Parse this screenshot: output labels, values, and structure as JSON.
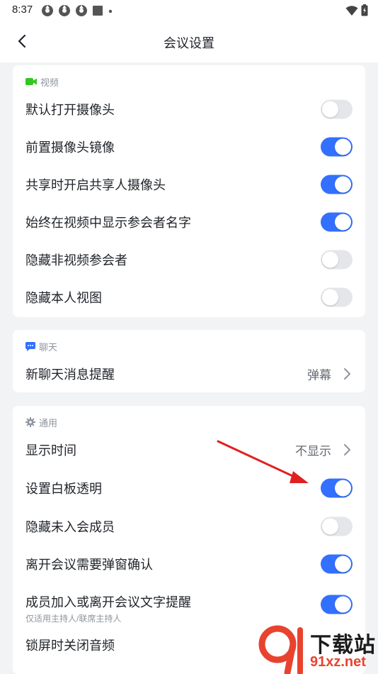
{
  "status_bar": {
    "time": "8:37"
  },
  "header": {
    "title": "会议设置"
  },
  "video_section": {
    "title": "视频",
    "items": [
      {
        "label": "默认打开摄像头",
        "on": false
      },
      {
        "label": "前置摄像头镜像",
        "on": true
      },
      {
        "label": "共享时开启共享人摄像头",
        "on": true
      },
      {
        "label": "始终在视频中显示参会者名字",
        "on": true
      },
      {
        "label": "隐藏非视频参会者",
        "on": false
      },
      {
        "label": "隐藏本人视图",
        "on": false
      }
    ]
  },
  "chat_section": {
    "title": "聊天",
    "items": [
      {
        "label": "新聊天消息提醒",
        "value": "弹幕"
      }
    ]
  },
  "general_section": {
    "title": "通用",
    "items": [
      {
        "label": "显示时间",
        "value": "不显示"
      },
      {
        "label": "设置白板透明",
        "on": true
      },
      {
        "label": "隐藏未入会成员",
        "on": false
      },
      {
        "label": "离开会议需要弹窗确认",
        "on": true
      },
      {
        "label": "成员加入或离开会议文字提醒",
        "sublabel": "仅适用主持人/联席主持人",
        "on": true
      },
      {
        "label": "锁屏时关闭音频"
      }
    ]
  },
  "watermark": {
    "brand": "下载站",
    "site": "91xz.net"
  },
  "colors": {
    "accent": "#3370ff",
    "toggle_off": "#e4e6ea",
    "annotation_arrow": "#e02020",
    "video_icon": "#34c724",
    "chat_icon": "#3370ff"
  }
}
